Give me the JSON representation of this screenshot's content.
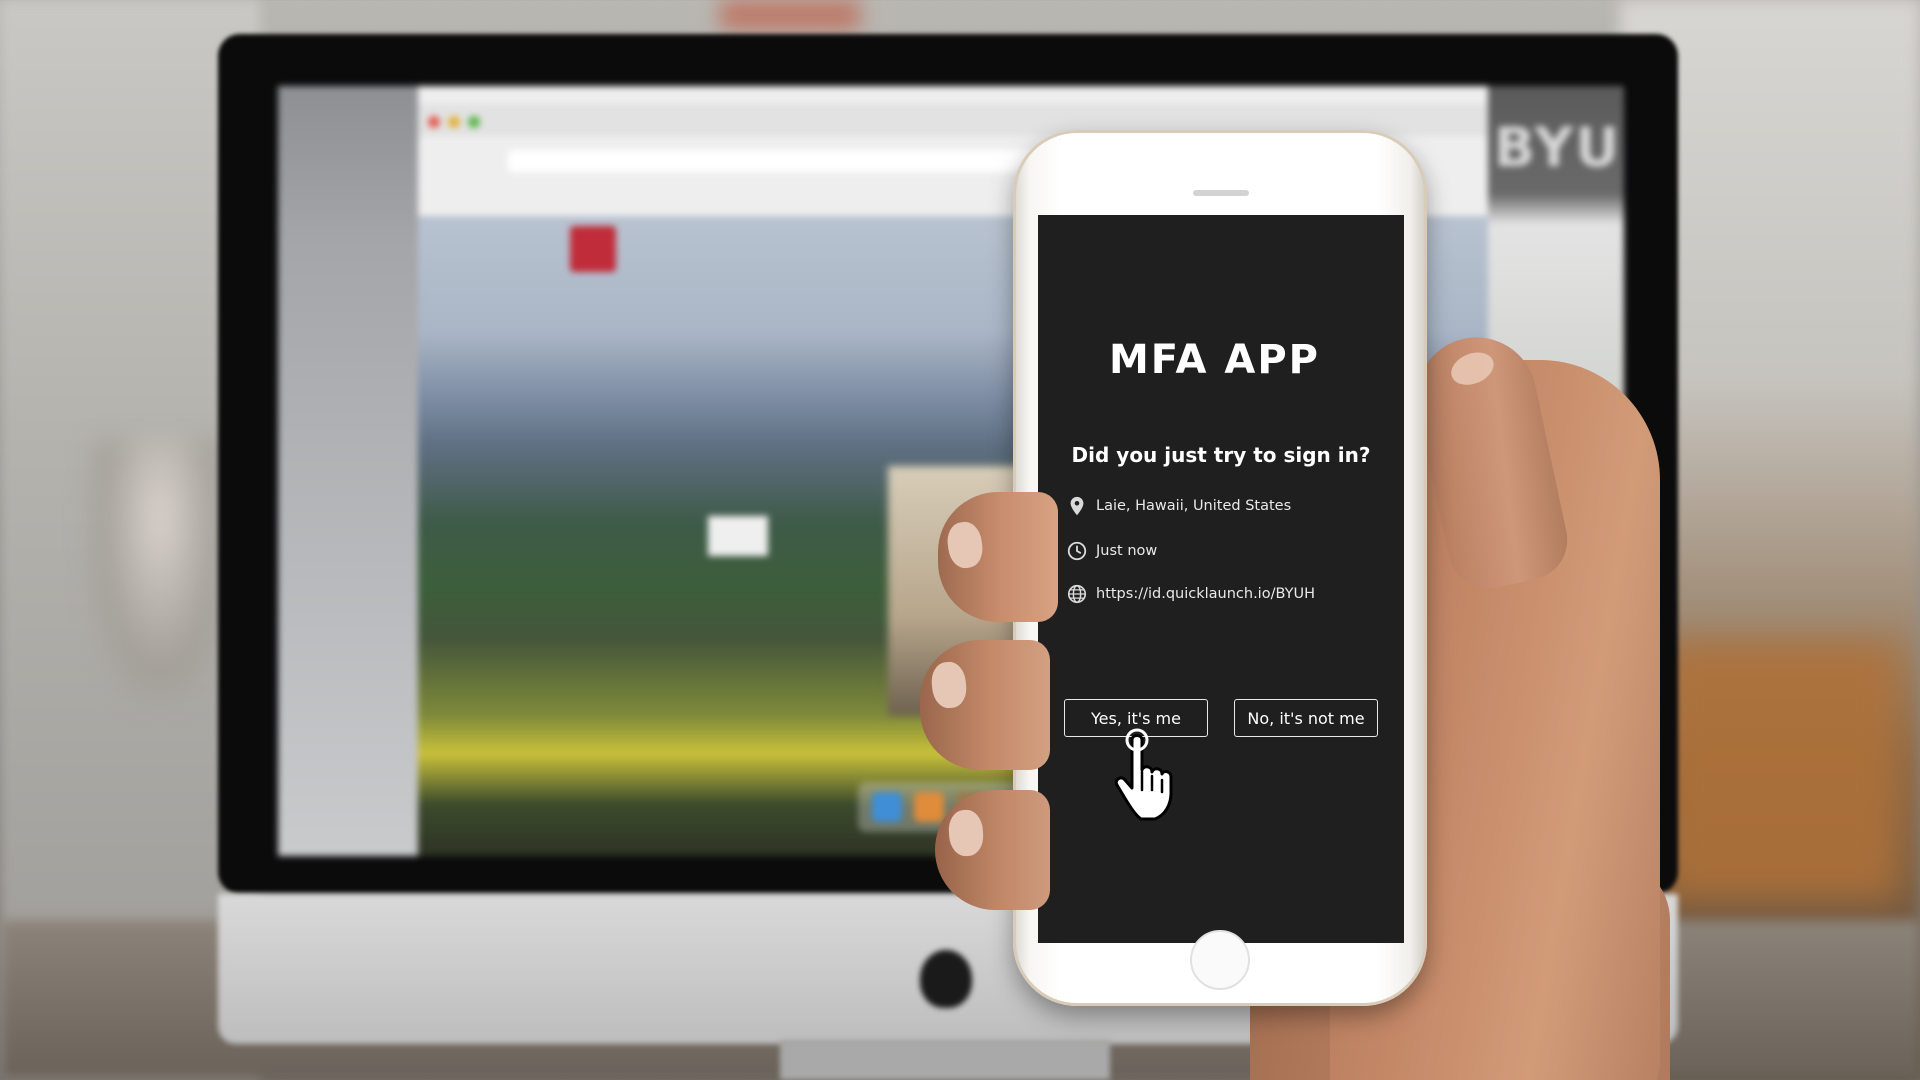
{
  "background": {
    "monitor_mark": "BYU"
  },
  "phone": {
    "app_title": "MFA APP",
    "prompt": "Did you just try to sign in?",
    "details": {
      "location": {
        "icon": "location-pin-icon",
        "text": "Laie, Hawaii, United States"
      },
      "time": {
        "icon": "clock-icon",
        "text": "Just now"
      },
      "url": {
        "icon": "globe-icon",
        "text": "https://id.quicklaunch.io/BYUH"
      }
    },
    "buttons": {
      "approve_label": "Yes, it's me",
      "deny_label": "No, it's not me"
    }
  },
  "colors": {
    "screen_bg": "#1f1f1f",
    "text": "#ffffff",
    "button_border": "#e8e8e8"
  }
}
